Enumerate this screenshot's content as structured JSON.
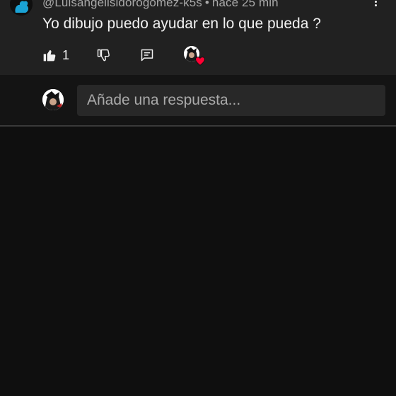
{
  "comment": {
    "author": "@Luisangelisidorogomez-k5s",
    "separator": "•",
    "time": "hace 25 min",
    "text": "Yo dibujo puedo ayudar en lo que pueda ?",
    "like_count": "1"
  },
  "reply": {
    "placeholder": "Añade una respuesta..."
  },
  "colors": {
    "background": "#0f0f0f",
    "comment_bg": "#212121",
    "input_bg": "#282828",
    "muted_text": "#aaaaaa",
    "heart": "#ff0033"
  }
}
